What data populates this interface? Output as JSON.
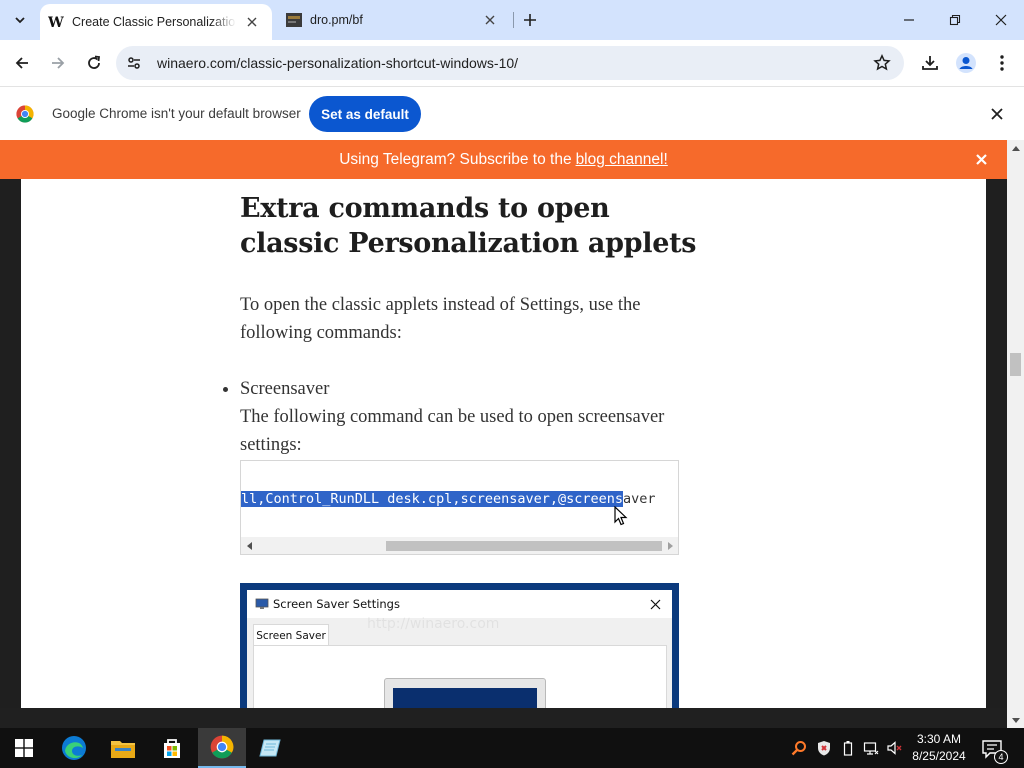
{
  "browser": {
    "tabs": [
      {
        "title": "Create Classic Personalization S",
        "favicon": "winaero-W",
        "active": true
      },
      {
        "title": "dro.pm/bf",
        "favicon": "dropm-icon",
        "active": false
      }
    ],
    "url": "winaero.com/classic-personalization-shortcut-windows-10/",
    "infobar": {
      "message": "Google Chrome isn't your default browser",
      "button": "Set as default"
    }
  },
  "banner": {
    "text": "Using Telegram? Subscribe to the",
    "link": "blog channel!",
    "color": "#f66a2b"
  },
  "article": {
    "heading": "Extra commands to open classic Personalization applets",
    "intro": "To open the classic applets instead of Settings, use the following commands:",
    "bullet_title": "Screensaver",
    "bullet_body": "The following command can be used to open screensaver settings:",
    "code_selected": "ll,Control_RunDLL desk.cpl,screensaver,@screens",
    "code_rest": "aver",
    "image": {
      "dialog_title": "Screen Saver Settings",
      "tab_label": "Screen Saver",
      "watermark": "http://winaero.com"
    }
  },
  "taskbar": {
    "apps": [
      "start-icon",
      "edge-icon",
      "file-explorer-icon",
      "store-icon",
      "chrome-icon",
      "notepad-icon"
    ],
    "time": "3:30 AM",
    "date": "8/25/2024",
    "notifications": "4"
  },
  "colors": {
    "tabstrip": "#d3e3fd",
    "accent": "#0b57d0",
    "selection": "#2f64c8"
  }
}
